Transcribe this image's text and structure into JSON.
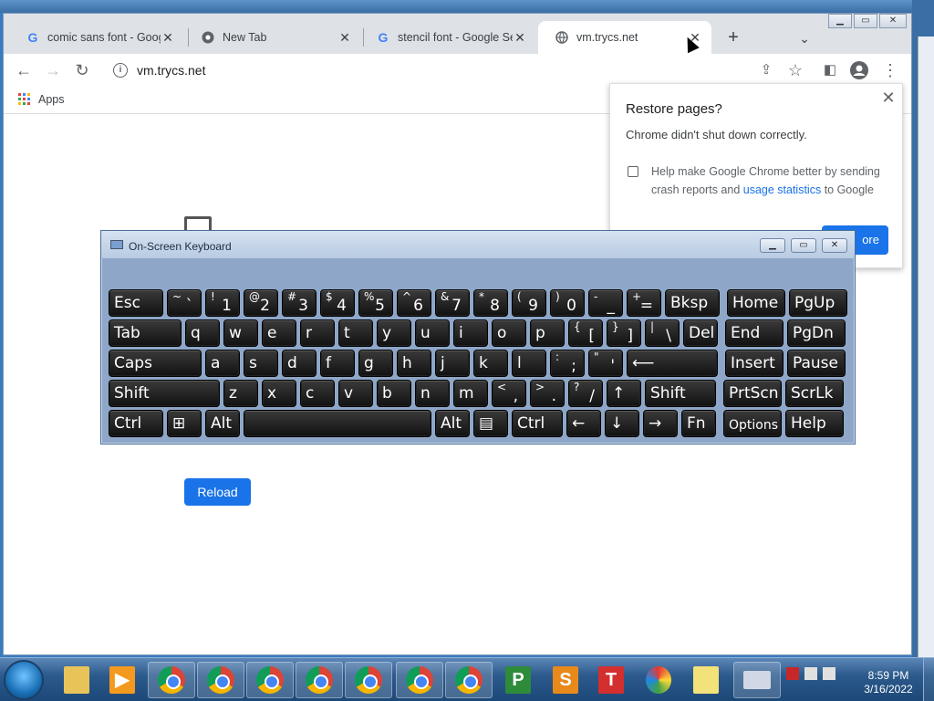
{
  "browser": {
    "tabs": [
      {
        "title": "comic sans font - Goog",
        "icon": "google-icon",
        "active": false
      },
      {
        "title": "New Tab",
        "icon": "chrome-icon",
        "active": false
      },
      {
        "title": "stencil font - Google Se",
        "icon": "google-icon",
        "active": false
      },
      {
        "title": "vm.trycs.net",
        "icon": "globe-icon",
        "active": true
      }
    ],
    "url": "vm.trycs.net",
    "bookmarks": {
      "apps_label": "Apps"
    },
    "page": {
      "reload_label": "Reload"
    }
  },
  "restore_dialog": {
    "title": "Restore pages?",
    "subtitle": "Chrome didn't shut down correctly.",
    "checkbox_label_start": "Help make Google Chrome better by sending crash reports and ",
    "checkbox_link": "usage statistics",
    "checkbox_label_end": " to Google",
    "button_label": "ore"
  },
  "osk": {
    "title": "On-Screen Keyboard",
    "rows": [
      [
        {
          "main": "Esc"
        },
        {
          "sh": "~",
          "bs": "`"
        },
        {
          "sh": "!",
          "bs": "1"
        },
        {
          "sh": "@",
          "bs": "2"
        },
        {
          "sh": "#",
          "bs": "3"
        },
        {
          "sh": "$",
          "bs": "4"
        },
        {
          "sh": "%",
          "bs": "5"
        },
        {
          "sh": "^",
          "bs": "6"
        },
        {
          "sh": "&",
          "bs": "7"
        },
        {
          "sh": "*",
          "bs": "8"
        },
        {
          "sh": "(",
          "bs": "9"
        },
        {
          "sh": ")",
          "bs": "0"
        },
        {
          "sh": "-",
          "bs": "_"
        },
        {
          "sh": "+",
          "bs": "="
        },
        {
          "main": "Bksp"
        },
        {
          "main": "Home"
        },
        {
          "main": "PgUp"
        }
      ],
      [
        {
          "main": "Tab"
        },
        {
          "main": "q"
        },
        {
          "main": "w"
        },
        {
          "main": "e"
        },
        {
          "main": "r"
        },
        {
          "main": "t"
        },
        {
          "main": "y"
        },
        {
          "main": "u"
        },
        {
          "main": "i"
        },
        {
          "main": "o"
        },
        {
          "main": "p"
        },
        {
          "sh": "{",
          "bs": "["
        },
        {
          "sh": "}",
          "bs": "]"
        },
        {
          "sh": "|",
          "bs": "\\"
        },
        {
          "main": "Del"
        },
        {
          "main": "End"
        },
        {
          "main": "PgDn"
        }
      ],
      [
        {
          "main": "Caps"
        },
        {
          "main": "a"
        },
        {
          "main": "s"
        },
        {
          "main": "d"
        },
        {
          "main": "f"
        },
        {
          "main": "g"
        },
        {
          "main": "h"
        },
        {
          "main": "j"
        },
        {
          "main": "k"
        },
        {
          "main": "l"
        },
        {
          "sh": ":",
          "bs": ";"
        },
        {
          "sh": "\"",
          "bs": "'"
        },
        {
          "main": "⟵"
        },
        {
          "main": "Insert"
        },
        {
          "main": "Pause"
        }
      ],
      [
        {
          "main": "Shift"
        },
        {
          "main": "z"
        },
        {
          "main": "x"
        },
        {
          "main": "c"
        },
        {
          "main": "v"
        },
        {
          "main": "b"
        },
        {
          "main": "n"
        },
        {
          "main": "m"
        },
        {
          "sh": "<",
          "bs": ","
        },
        {
          "sh": ">",
          "bs": "."
        },
        {
          "sh": "?",
          "bs": "/"
        },
        {
          "main": "↑"
        },
        {
          "main": "Shift"
        },
        {
          "main": "PrtScn"
        },
        {
          "main": "ScrLk"
        }
      ],
      [
        {
          "main": "Ctrl"
        },
        {
          "main": "⊞"
        },
        {
          "main": "Alt"
        },
        {
          "main": ""
        },
        {
          "main": "Alt"
        },
        {
          "main": "▤"
        },
        {
          "main": "Ctrl"
        },
        {
          "main": "←"
        },
        {
          "main": "↓"
        },
        {
          "main": "→"
        },
        {
          "main": "Fn"
        },
        {
          "main": "Options"
        },
        {
          "main": "Help"
        }
      ]
    ]
  },
  "taskbar": {
    "items": [
      "explorer-icon",
      "media-icon",
      "chrome-icon",
      "chrome-icon",
      "chrome-icon",
      "chrome-icon",
      "chrome-icon",
      "chrome-icon",
      "chrome-icon",
      "project-icon",
      "slides-icon",
      "text-icon",
      "paint-icon",
      "folder-icon",
      "keyboard-icon"
    ],
    "time": "8:59 PM",
    "date": "3/16/2022"
  }
}
